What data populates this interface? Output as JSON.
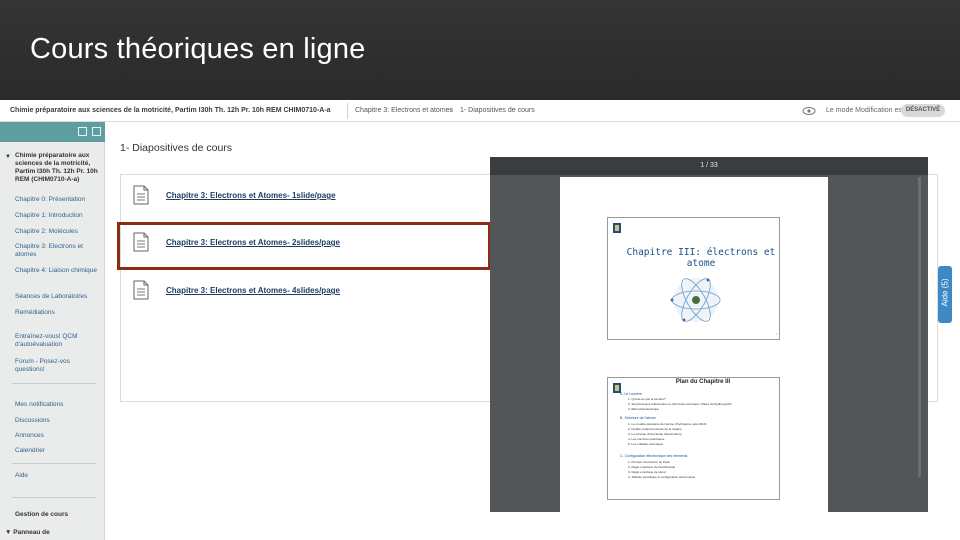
{
  "slide": {
    "title": "Cours théoriques en ligne"
  },
  "topbar": {
    "course": "Chimie préparatoire aux sciences de la motricité, Partim I30h Th. 12h Pr. 10h REM CHIM0710-A-a",
    "breadcrumb": [
      "Chapitre 3: Electrons et atomes",
      "1- Diapositives de cours"
    ],
    "edit_mode_label": "Le mode Modification est :",
    "edit_mode_state": "DÉSACTIVÉ"
  },
  "sidebar": {
    "root": "Chimie préparatoire aux sciences de la motricité, Partim I30h Th. 12h Pr. 10h REM (CHIM0710-A-a)",
    "items": [
      "Chapitre 0: Présentation",
      "Chapitre 1: Introduction",
      "Chapitre 2: Molécules",
      "Chapitre 3: Electrons et atomes",
      "Chapitre 4: Liaison chimique",
      "Séances de Laboratoires",
      "Remédiations",
      "Entraînez-vous! QCM d'autoévaluation",
      "Forum - Posez-vos questions!",
      "Mes notifications",
      "Discussions",
      "Annonces",
      "Calendrier",
      "Aide"
    ],
    "section_management": "Gestion de cours",
    "control_panel": "Panneau de"
  },
  "content": {
    "title": "1- Diapositives de cours",
    "files": [
      "Chapitre 3: Electrons et Atomes- 1slide/page",
      "Chapitre 3: Electrons et Atomes- 2slides/page",
      "Chapitre 3: Electrons et Atomes- 4slides/page"
    ]
  },
  "help": {
    "label": "Aide (5)"
  },
  "pdf": {
    "page_indicator": "1 / 33",
    "slide1_title": "Chapitre III: électrons et atome",
    "slide2_title": "Plan du Chapitre III",
    "slide2_lines": [
      "A- Le Lumière",
      "1- Qu'est-ce que la lumière?",
      "2- Spectroscopie d'absorption et d'émission atomique / Raies de Rydberg-Ritz",
      "3- Effet photoélectrique",
      "B- Structure de l'atome",
      "1- Le modèle planétaire de l'atome d'hydrogène selon Bohr",
      "2- Dualité onde/corpuscule de la matière",
      "3- Le principe d'incertitude d'Heisenberg",
      "4- Les nombres quantiques",
      "5- Les orbitales atomiques",
      "C- Configuration électronique des éléments",
      "1- Principe d'exclusion de Pauli",
      "2- Règle empirique de Klechkowski",
      "3- Règle empirique de Hund",
      "4- Tableau périodique et configuration électronique"
    ],
    "page_number": "1"
  },
  "colors": {
    "accent": "#5f9ea0",
    "highlight": "#8b2d14",
    "link": "#1f3d63",
    "help": "#3d89c5"
  }
}
